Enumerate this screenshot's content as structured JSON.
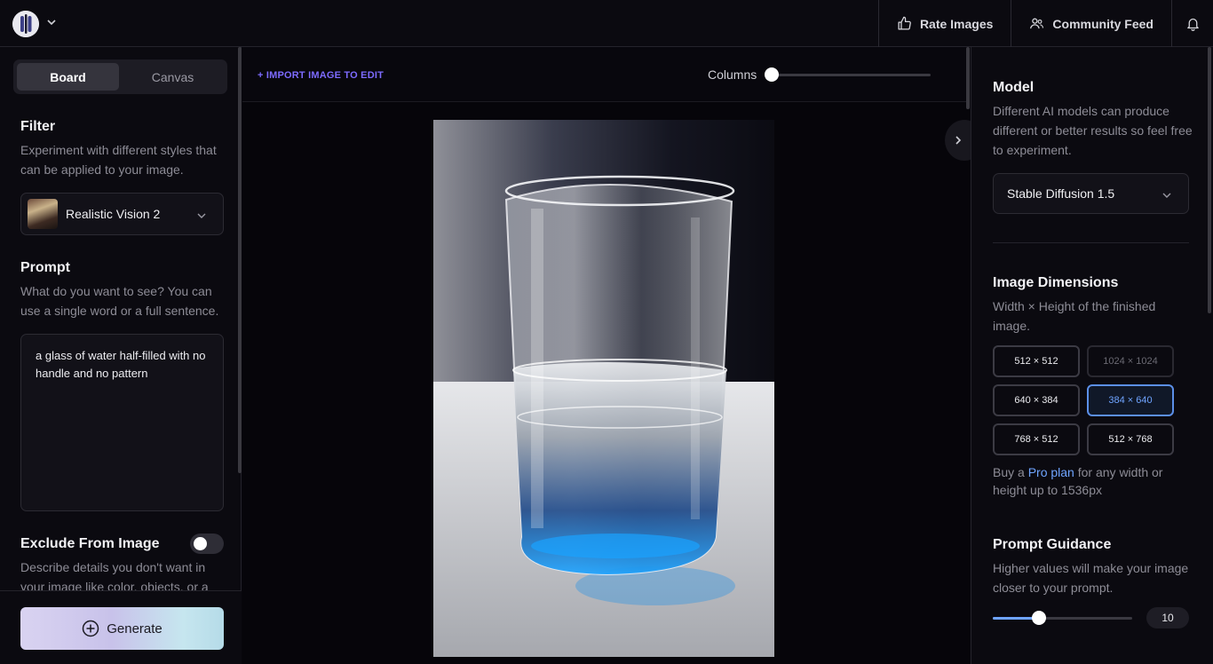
{
  "topbar": {
    "rate_label": "Rate Images",
    "community_label": "Community Feed"
  },
  "left": {
    "tabs": [
      {
        "label": "Board",
        "active": true
      },
      {
        "label": "Canvas",
        "active": false
      }
    ],
    "filter": {
      "title": "Filter",
      "description": "Experiment with different styles that can be applied to your image.",
      "selected": "Realistic Vision 2"
    },
    "prompt": {
      "title": "Prompt",
      "description": "What do you want to see? You can use a single word or a full sentence.",
      "value": "a glass of water half-filled with no handle and no pattern"
    },
    "exclude": {
      "title": "Exclude From Image",
      "description": "Describe details you don't want in your image like color, objects, or a",
      "enabled": false
    },
    "generate_label": "Generate"
  },
  "center": {
    "import_label": "+ IMPORT IMAGE TO EDIT",
    "columns_label": "Columns"
  },
  "right": {
    "model": {
      "title": "Model",
      "description": "Different AI models can produce different or better results so feel free to experiment.",
      "selected": "Stable Diffusion 1.5"
    },
    "dimensions": {
      "title": "Image Dimensions",
      "description": "Width × Height of the finished image.",
      "options": [
        {
          "label": "512 × 512",
          "state": "normal"
        },
        {
          "label": "1024 × 1024",
          "state": "disabled"
        },
        {
          "label": "640 × 384",
          "state": "normal"
        },
        {
          "label": "384 × 640",
          "state": "selected"
        },
        {
          "label": "768 × 512",
          "state": "normal"
        },
        {
          "label": "512 × 768",
          "state": "normal"
        }
      ],
      "pro_prefix": "Buy a ",
      "pro_link": "Pro plan",
      "pro_suffix": " for any width or height up to 1536px"
    },
    "guidance": {
      "title": "Prompt Guidance",
      "description": "Higher values will make your image closer to your prompt.",
      "value": "10"
    }
  },
  "colors": {
    "accent": "#6fa4ff",
    "import_link": "#7d6bff"
  }
}
